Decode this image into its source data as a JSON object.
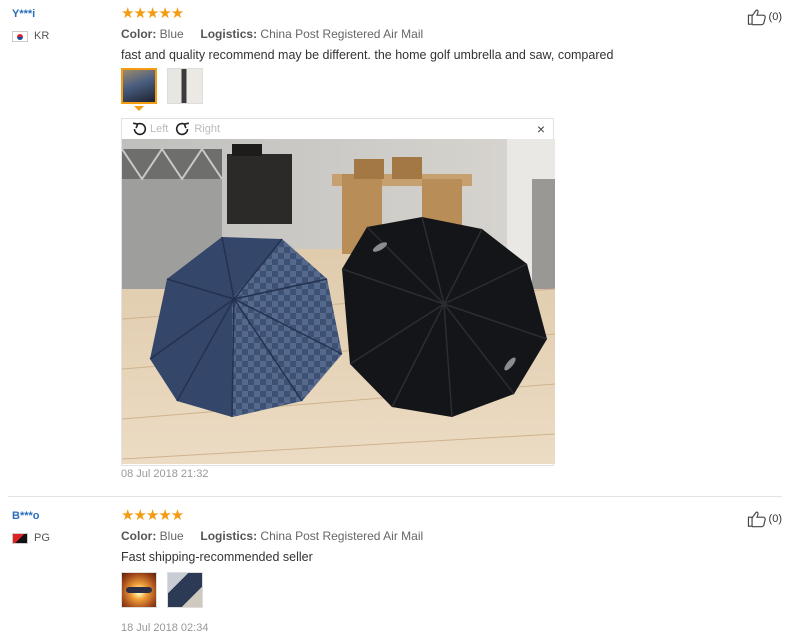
{
  "reviews": [
    {
      "username": "Y***i",
      "country": "KR",
      "stars": "★★★★★",
      "color_label": "Color:",
      "color_value": "Blue",
      "logistics_label": "Logistics:",
      "logistics_value": "China Post Registered Air Mail",
      "text": "fast and quality recommend may be different. the home golf umbrella and saw, compared",
      "date": "08 Jul 2018 21:32",
      "likes": "(0)",
      "viewer": {
        "rotate_left": "Left",
        "rotate_right": "Right",
        "close": "×"
      }
    },
    {
      "username": "B***o",
      "country": "PG",
      "stars": "★★★★★",
      "color_label": "Color:",
      "color_value": "Blue",
      "logistics_label": "Logistics:",
      "logistics_value": "China Post Registered Air Mail",
      "text": "Fast shipping-recommended seller",
      "date": "18 Jul 2018 02:34",
      "likes": "(0)"
    }
  ],
  "icons": {
    "like": "thumbs-up-icon",
    "rotate_left": "rotate-left-icon",
    "rotate_right": "rotate-right-icon",
    "close": "close-icon"
  },
  "colors": {
    "username": "#2a6ebb",
    "stars": "#f39c12",
    "active_thumb": "#f39c12"
  }
}
